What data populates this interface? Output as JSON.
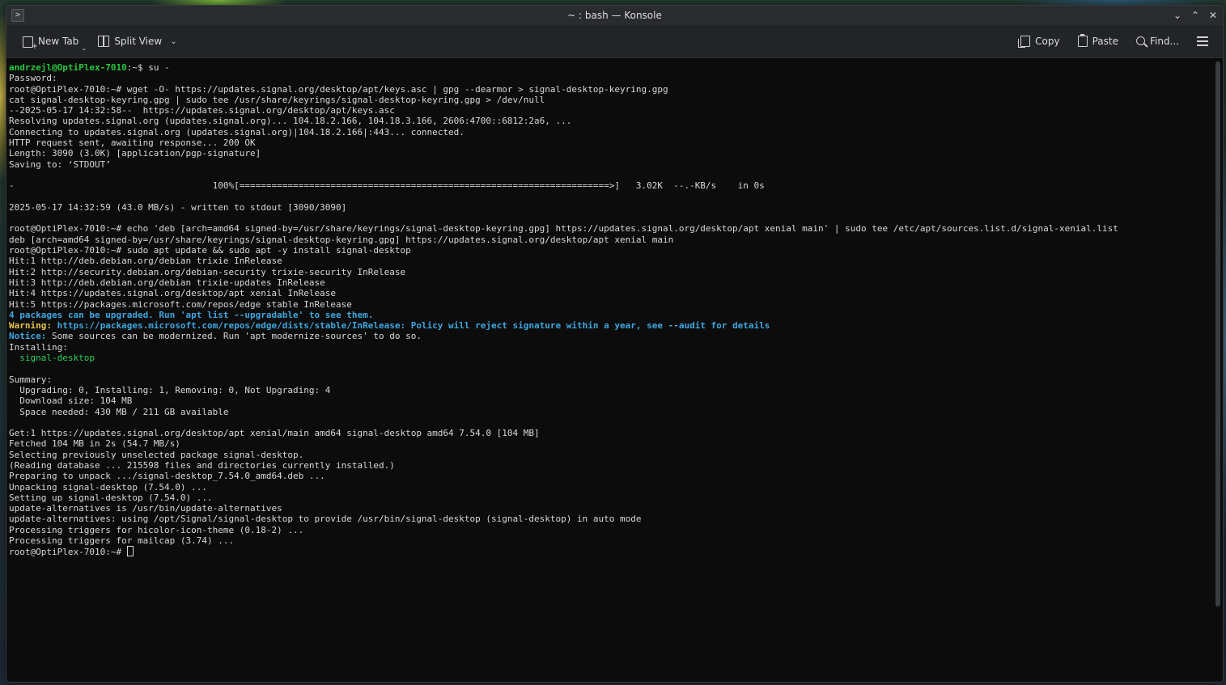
{
  "window": {
    "title": "~ : bash — Konsole"
  },
  "toolbar": {
    "new_tab_label": "New Tab",
    "split_view_label": "Split View",
    "copy_label": "Copy",
    "paste_label": "Paste",
    "find_label": "Find..."
  },
  "icons": {
    "new_tab": "new-tab-icon",
    "split_view": "split-view-icon",
    "copy": "copy-icon",
    "paste": "paste-icon",
    "find": "search-icon",
    "menu": "hamburger-menu-icon"
  },
  "colors": {
    "prompt_user": "#27c93f",
    "info_blue": "#3fa7e0",
    "warning_yellow": "#e5c14a",
    "package_green": "#2fd25a",
    "terminal_bg": "#0c0c0c",
    "terminal_fg": "#d8d8d8"
  },
  "terminal": {
    "lines": [
      {
        "segments": [
          {
            "t": "andrzejl@OptiPlex-7010",
            "c": "c-green"
          },
          {
            "t": ":~$ su -",
            "c": ""
          }
        ]
      },
      {
        "segments": [
          {
            "t": "Password:",
            "c": ""
          }
        ]
      },
      {
        "segments": [
          {
            "t": "root@OptiPlex-7010:~# wget -O- https://updates.signal.org/desktop/apt/keys.asc | gpg --dearmor > signal-desktop-keyring.gpg",
            "c": ""
          }
        ]
      },
      {
        "segments": [
          {
            "t": "cat signal-desktop-keyring.gpg | sudo tee /usr/share/keyrings/signal-desktop-keyring.gpg > /dev/null",
            "c": ""
          }
        ]
      },
      {
        "segments": [
          {
            "t": "--2025-05-17 14:32:58--  https://updates.signal.org/desktop/apt/keys.asc",
            "c": ""
          }
        ]
      },
      {
        "segments": [
          {
            "t": "Resolving updates.signal.org (updates.signal.org)... 104.18.2.166, 104.18.3.166, 2606:4700::6812:2a6, ...",
            "c": ""
          }
        ]
      },
      {
        "segments": [
          {
            "t": "Connecting to updates.signal.org (updates.signal.org)|104.18.2.166|:443... connected.",
            "c": ""
          }
        ]
      },
      {
        "segments": [
          {
            "t": "HTTP request sent, awaiting response... 200 OK",
            "c": ""
          }
        ]
      },
      {
        "segments": [
          {
            "t": "Length: 3090 (3.0K) [application/pgp-signature]",
            "c": ""
          }
        ]
      },
      {
        "segments": [
          {
            "t": "Saving to: ‘STDOUT’",
            "c": ""
          }
        ]
      },
      {
        "segments": [
          {
            "t": "",
            "c": ""
          }
        ]
      },
      {
        "segments": [
          {
            "t": "-                                     100%[=====================================================================>]   3.02K  --.-KB/s    in 0s",
            "c": ""
          }
        ]
      },
      {
        "segments": [
          {
            "t": "",
            "c": ""
          }
        ]
      },
      {
        "segments": [
          {
            "t": "2025-05-17 14:32:59 (43.0 MB/s) - written to stdout [3090/3090]",
            "c": ""
          }
        ]
      },
      {
        "segments": [
          {
            "t": "",
            "c": ""
          }
        ]
      },
      {
        "segments": [
          {
            "t": "root@OptiPlex-7010:~# echo 'deb [arch=amd64 signed-by=/usr/share/keyrings/signal-desktop-keyring.gpg] https://updates.signal.org/desktop/apt xenial main' | sudo tee /etc/apt/sources.list.d/signal-xenial.list",
            "c": ""
          }
        ]
      },
      {
        "segments": [
          {
            "t": "deb [arch=amd64 signed-by=/usr/share/keyrings/signal-desktop-keyring.gpg] https://updates.signal.org/desktop/apt xenial main",
            "c": ""
          }
        ]
      },
      {
        "segments": [
          {
            "t": "root@OptiPlex-7010:~# sudo apt update && sudo apt -y install signal-desktop",
            "c": ""
          }
        ]
      },
      {
        "segments": [
          {
            "t": "Hit:1 http://deb.debian.org/debian trixie InRelease",
            "c": ""
          }
        ]
      },
      {
        "segments": [
          {
            "t": "Hit:2 http://security.debian.org/debian-security trixie-security InRelease",
            "c": ""
          }
        ]
      },
      {
        "segments": [
          {
            "t": "Hit:3 http://deb.debian.org/debian trixie-updates InRelease",
            "c": ""
          }
        ]
      },
      {
        "segments": [
          {
            "t": "Hit:4 https://updates.signal.org/desktop/apt xenial InRelease",
            "c": ""
          }
        ]
      },
      {
        "segments": [
          {
            "t": "Hit:5 https://packages.microsoft.com/repos/edge stable InRelease",
            "c": ""
          }
        ]
      },
      {
        "segments": [
          {
            "t": "4 packages can be upgraded. Run 'apt list --upgradable' to see them.",
            "c": "c-blue"
          }
        ]
      },
      {
        "segments": [
          {
            "t": "Warning:",
            "c": "c-yellow"
          },
          {
            "t": " https://packages.microsoft.com/repos/edge/dists/stable/InRelease: Policy will reject signature within a year, see --audit for details",
            "c": "c-blue"
          }
        ]
      },
      {
        "segments": [
          {
            "t": "Notice:",
            "c": "c-blue"
          },
          {
            "t": " Some sources can be modernized. Run 'apt modernize-sources' to do so.",
            "c": ""
          }
        ]
      },
      {
        "segments": [
          {
            "t": "Installing:",
            "c": ""
          }
        ]
      },
      {
        "segments": [
          {
            "t": "  ",
            "c": ""
          },
          {
            "t": "signal-desktop",
            "c": "c-gbrt"
          }
        ]
      },
      {
        "segments": [
          {
            "t": "",
            "c": ""
          }
        ]
      },
      {
        "segments": [
          {
            "t": "Summary:",
            "c": ""
          }
        ]
      },
      {
        "segments": [
          {
            "t": "  Upgrading: 0, Installing: 1, Removing: 0, Not Upgrading: 4",
            "c": ""
          }
        ]
      },
      {
        "segments": [
          {
            "t": "  Download size: 104 MB",
            "c": ""
          }
        ]
      },
      {
        "segments": [
          {
            "t": "  Space needed: 430 MB / 211 GB available",
            "c": ""
          }
        ]
      },
      {
        "segments": [
          {
            "t": "",
            "c": ""
          }
        ]
      },
      {
        "segments": [
          {
            "t": "Get:1 https://updates.signal.org/desktop/apt xenial/main amd64 signal-desktop amd64 7.54.0 [104 MB]",
            "c": ""
          }
        ]
      },
      {
        "segments": [
          {
            "t": "Fetched 104 MB in 2s (54.7 MB/s)",
            "c": ""
          }
        ]
      },
      {
        "segments": [
          {
            "t": "Selecting previously unselected package signal-desktop.",
            "c": ""
          }
        ]
      },
      {
        "segments": [
          {
            "t": "(Reading database ... 215598 files and directories currently installed.)",
            "c": ""
          }
        ]
      },
      {
        "segments": [
          {
            "t": "Preparing to unpack .../signal-desktop_7.54.0_amd64.deb ...",
            "c": ""
          }
        ]
      },
      {
        "segments": [
          {
            "t": "Unpacking signal-desktop (7.54.0) ...",
            "c": ""
          }
        ]
      },
      {
        "segments": [
          {
            "t": "Setting up signal-desktop (7.54.0) ...",
            "c": ""
          }
        ]
      },
      {
        "segments": [
          {
            "t": "update-alternatives is /usr/bin/update-alternatives",
            "c": ""
          }
        ]
      },
      {
        "segments": [
          {
            "t": "update-alternatives: using /opt/Signal/signal-desktop to provide /usr/bin/signal-desktop (signal-desktop) in auto mode",
            "c": ""
          }
        ]
      },
      {
        "segments": [
          {
            "t": "Processing triggers for hicolor-icon-theme (0.18-2) ...",
            "c": ""
          }
        ]
      },
      {
        "segments": [
          {
            "t": "Processing triggers for mailcap (3.74) ...",
            "c": ""
          }
        ]
      },
      {
        "segments": [
          {
            "t": "root@OptiPlex-7010:~# ",
            "c": ""
          }
        ],
        "cursor": true
      }
    ]
  }
}
